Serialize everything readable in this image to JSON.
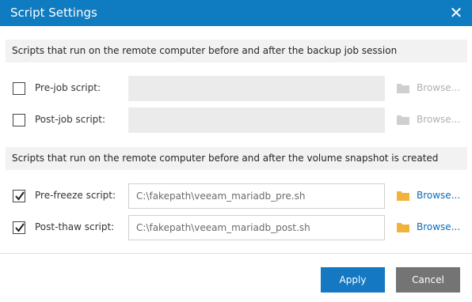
{
  "dialog": {
    "title": "Script Settings"
  },
  "icons": {
    "close": "close-icon",
    "check": "check-icon",
    "folder": "folder-icon"
  },
  "colors": {
    "titlebar": "#0f7bc0",
    "apply_button": "#1479c2",
    "cancel_button": "#747474",
    "link": "#0f6bb5",
    "folder_enabled": "#f2b33a",
    "folder_disabled": "#cfcfcf"
  },
  "sections": [
    {
      "header": "Scripts that run on the remote computer before and after the backup job session",
      "rows": [
        {
          "label": "Pre-job script:",
          "checked": false,
          "value": "",
          "enabled": false,
          "browse": "Browse..."
        },
        {
          "label": "Post-job script:",
          "checked": false,
          "value": "",
          "enabled": false,
          "browse": "Browse..."
        }
      ]
    },
    {
      "header": "Scripts that run on the remote computer before and after the volume snapshot is created",
      "rows": [
        {
          "label": "Pre-freeze script:",
          "checked": true,
          "value": "C:\\fakepath\\veeam_mariadb_pre.sh",
          "enabled": true,
          "browse": "Browse..."
        },
        {
          "label": "Post-thaw script:",
          "checked": true,
          "value": "C:\\fakepath\\veeam_mariadb_post.sh",
          "enabled": true,
          "browse": "Browse..."
        }
      ]
    }
  ],
  "buttons": {
    "apply": "Apply",
    "cancel": "Cancel"
  }
}
